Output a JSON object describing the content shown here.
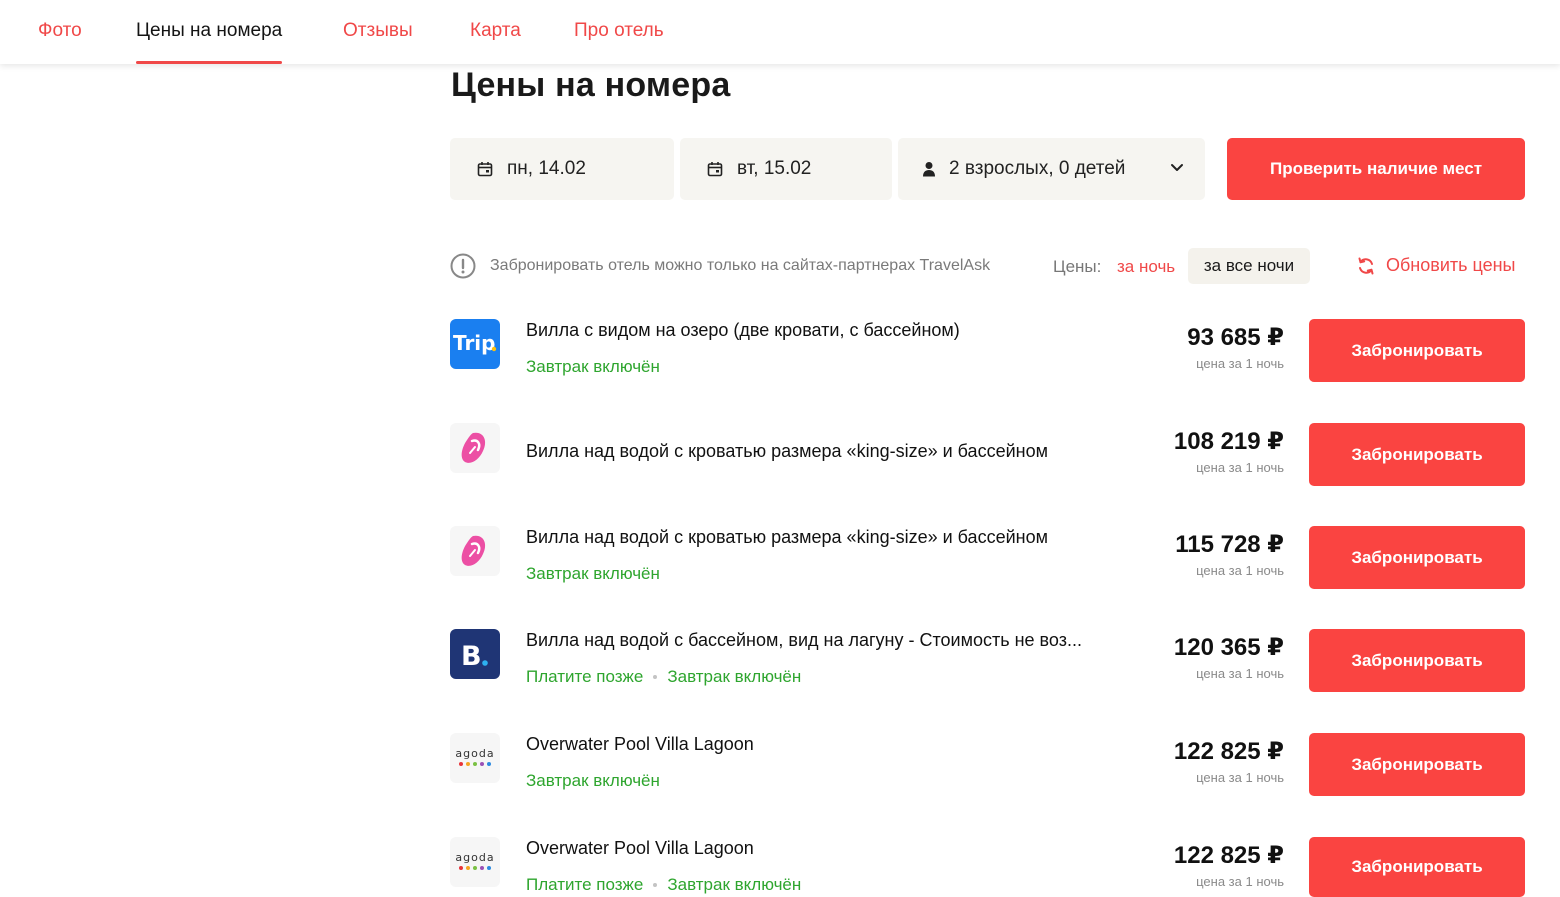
{
  "nav": {
    "tabs": [
      {
        "label": "Фото"
      },
      {
        "label": "Цены на номера"
      },
      {
        "label": "Отзывы"
      },
      {
        "label": "Карта"
      },
      {
        "label": "Про отель"
      }
    ],
    "active_tab": "Цены на номера"
  },
  "title": "Цены на номера",
  "search": {
    "checkin": "пн, 14.02",
    "checkout": "вт, 15.02",
    "guests": "2 взрослых, 0 детей",
    "check_label": "Проверить наличие мест"
  },
  "notice": "Забронировать отель можно только на сайтах-партнерах TravelAsk",
  "prices_toggle": {
    "label": "Цены:",
    "per_night": "за ночь",
    "all_nights": "за все ночи",
    "selected": "за все ночи"
  },
  "refresh_label": "Обновить цены",
  "offers": [
    {
      "provider_icon": "trip-logo-icon",
      "logo_text": "Trip",
      "name": "Вилла с видом на озеро (две кровати, с бассейном)",
      "tags": [
        "Завтрак включён"
      ],
      "price": "93 685 ₽",
      "per": "цена за 1 ночь",
      "book": "Забронировать"
    },
    {
      "provider_icon": "ostrovok-logo-icon",
      "name": "Вилла над водой с кроватью размера «king-size» и бассейном",
      "tags": [],
      "price": "108 219 ₽",
      "per": "цена за 1 ночь",
      "book": "Забронировать"
    },
    {
      "provider_icon": "ostrovok-logo-icon",
      "name": "Вилла над водой с кроватью размера «king-size» и бассейном",
      "tags": [
        "Завтрак включён"
      ],
      "price": "115 728 ₽",
      "per": "цена за 1 ночь",
      "book": "Забронировать"
    },
    {
      "provider_icon": "booking-logo-icon",
      "logo_text": "B",
      "name": "Вилла над водой с бассейном, вид на лагуну - Стоимость не воз...",
      "tags": [
        "Платите позже",
        "Завтрак включён"
      ],
      "price": "120 365 ₽",
      "per": "цена за 1 ночь",
      "book": "Забронировать"
    },
    {
      "provider_icon": "agoda-logo-icon",
      "logo_text": "agoda",
      "name": "Overwater Pool Villa Lagoon",
      "tags": [
        "Завтрак включён"
      ],
      "price": "122 825 ₽",
      "per": "цена за 1 ночь",
      "book": "Забронировать"
    },
    {
      "provider_icon": "agoda-logo-icon",
      "logo_text": "agoda",
      "name": "Overwater Pool Villa Lagoon",
      "tags": [
        "Платите позже",
        "Завтрак включён"
      ],
      "price": "122 825 ₽",
      "per": "цена за 1 ночь",
      "book": "Забронировать"
    }
  ],
  "colors": {
    "accent": "#fa4441",
    "included_green": "#2ea52e",
    "field_bg": "#f6f5f1",
    "trip_blue": "#1a7ff0",
    "booking_navy": "#1f3575",
    "ostrovok_pink": "#ec4fa4"
  }
}
